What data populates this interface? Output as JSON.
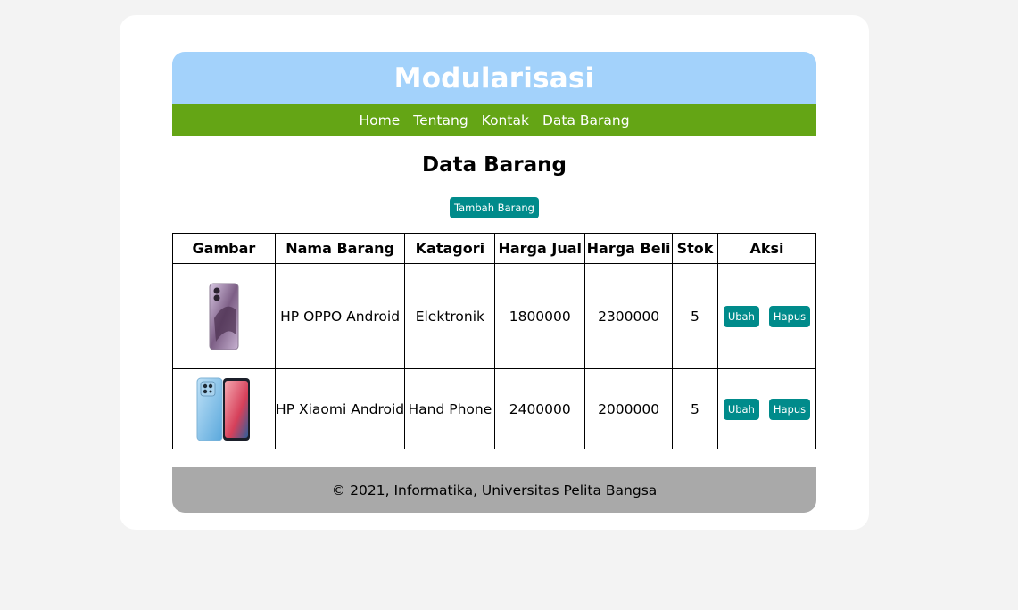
{
  "header": {
    "title": "Modularisasi"
  },
  "nav": {
    "items": [
      "Home",
      "Tentang",
      "Kontak",
      "Data Barang"
    ]
  },
  "content": {
    "title": "Data Barang",
    "add_button": "Tambah Barang"
  },
  "table": {
    "headers": [
      "Gambar",
      "Nama Barang",
      "Katagori",
      "Harga Jual",
      "Harga Beli",
      "Stok",
      "Aksi"
    ],
    "rows": [
      {
        "image": "oppo-phone-image",
        "nama": "HP OPPO Android",
        "kategori": "Elektronik",
        "harga_jual": "1800000",
        "harga_beli": "2300000",
        "stok": "5",
        "edit": "Ubah",
        "delete": "Hapus"
      },
      {
        "image": "xiaomi-phone-image",
        "nama": "HP Xiaomi Android",
        "kategori": "Hand Phone",
        "harga_jual": "2400000",
        "harga_beli": "2000000",
        "stok": "5",
        "edit": "Ubah",
        "delete": "Hapus"
      }
    ]
  },
  "footer": {
    "text": "© 2021, Informatika, Universitas Pelita Bangsa"
  },
  "colors": {
    "header": "#a3d2fb",
    "nav": "#64a515",
    "button": "#008b8b",
    "footer": "#a9a9a9"
  }
}
